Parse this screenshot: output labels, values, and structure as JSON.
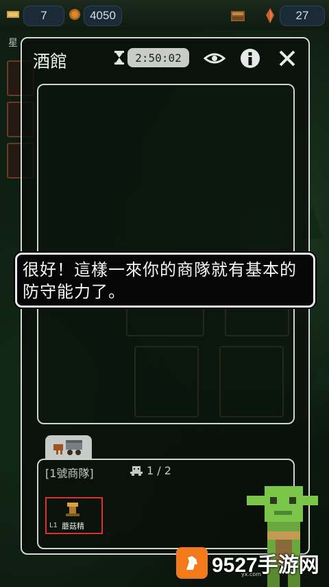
{
  "resources": {
    "left_value": "7",
    "gold_value": "4050",
    "right_value": "27"
  },
  "sidebar": {
    "label": "星"
  },
  "panel": {
    "title": "酒館",
    "timer": "2:50:02"
  },
  "dialog": {
    "text": "很好！這樣一來你的商隊就有基本的防守能力了。"
  },
  "caravan": {
    "title": "[1號商隊]",
    "slot_count": "1 / 2",
    "members": [
      {
        "level": "L1",
        "name": "蘑菇精"
      }
    ]
  },
  "watermark": {
    "text": "9527手游网",
    "sub": "yx.com"
  },
  "colors": {
    "panel_border": "#d7dcd7",
    "selected_border": "#e0312d",
    "watermark_orange": "#f27a1a"
  },
  "icons": [
    "gem-icon",
    "coin-icon",
    "trade-goods-icon",
    "crystal-icon",
    "hourglass-icon",
    "eye-icon",
    "info-icon",
    "close-icon",
    "caravan-cart-icon",
    "goblin-slot-icon",
    "goblin-guide"
  ]
}
